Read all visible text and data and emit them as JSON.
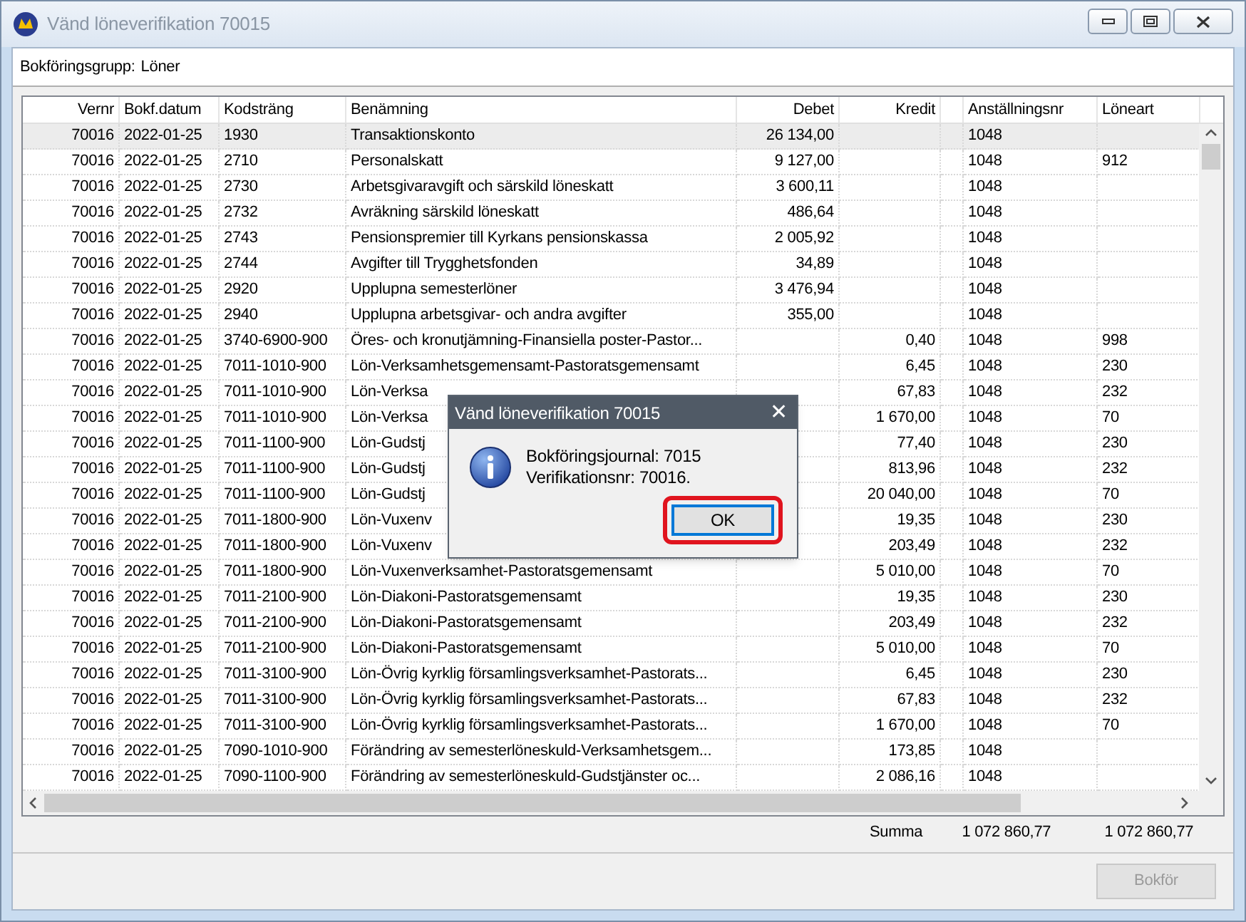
{
  "window": {
    "title": "Vänd löneverifikation 70015"
  },
  "group": {
    "label": "Bokföringsgrupp:",
    "value": "Löner"
  },
  "table": {
    "columns": [
      "Vernr",
      "Bokf.datum",
      "Kodsträng",
      "Benämning",
      "Debet",
      "Kredit",
      "Anställningsnr",
      "Löneart"
    ],
    "rows": [
      {
        "selected": true,
        "vernr": "70016",
        "datum": "2022-01-25",
        "kod": "1930",
        "benamning": "Transaktionskonto",
        "debet": "26 134,00",
        "anst": "1048"
      },
      {
        "selected": false,
        "vernr": "70016",
        "datum": "2022-01-25",
        "kod": "2710",
        "benamning": "Personalskatt",
        "debet": "9 127,00",
        "anst": "1048",
        "loneart": "912"
      },
      {
        "selected": false,
        "vernr": "70016",
        "datum": "2022-01-25",
        "kod": "2730",
        "benamning": "Arbetsgivaravgift och särskild löneskatt",
        "debet": "3 600,11",
        "anst": "1048"
      },
      {
        "selected": false,
        "vernr": "70016",
        "datum": "2022-01-25",
        "kod": "2732",
        "benamning": "Avräkning särskild löneskatt",
        "debet": "486,64",
        "anst": "1048"
      },
      {
        "selected": false,
        "vernr": "70016",
        "datum": "2022-01-25",
        "kod": "2743",
        "benamning": "Pensionspremier till Kyrkans pensionskassa",
        "debet": "2 005,92",
        "anst": "1048"
      },
      {
        "selected": false,
        "vernr": "70016",
        "datum": "2022-01-25",
        "kod": "2744",
        "benamning": "Avgifter till Trygghetsfonden",
        "debet": "34,89",
        "anst": "1048"
      },
      {
        "selected": false,
        "vernr": "70016",
        "datum": "2022-01-25",
        "kod": "2920",
        "benamning": "Upplupna semesterlöner",
        "debet": "3 476,94",
        "anst": "1048"
      },
      {
        "selected": false,
        "vernr": "70016",
        "datum": "2022-01-25",
        "kod": "2940",
        "benamning": "Upplupna arbetsgivar- och andra avgifter",
        "debet": "355,00",
        "anst": "1048"
      },
      {
        "selected": false,
        "vernr": "70016",
        "datum": "2022-01-25",
        "kod": "3740-6900-900",
        "benamning": "Öres- och kronutjämning-Finansiella poster-Pastor...",
        "kredit": "0,40",
        "anst": "1048",
        "loneart": "998"
      },
      {
        "selected": false,
        "vernr": "70016",
        "datum": "2022-01-25",
        "kod": "7011-1010-900",
        "benamning": "Lön-Verksamhetsgemensamt-Pastoratsgemensamt",
        "kredit": "6,45",
        "anst": "1048",
        "loneart": "230"
      },
      {
        "selected": false,
        "vernr": "70016",
        "datum": "2022-01-25",
        "kod": "7011-1010-900",
        "benamning": "Lön-Verksa",
        "kredit": "67,83",
        "anst": "1048",
        "loneart": "232"
      },
      {
        "selected": false,
        "vernr": "70016",
        "datum": "2022-01-25",
        "kod": "7011-1010-900",
        "benamning": "Lön-Verksa",
        "kredit": "1 670,00",
        "anst": "1048",
        "loneart": "70"
      },
      {
        "selected": false,
        "vernr": "70016",
        "datum": "2022-01-25",
        "kod": "7011-1100-900",
        "benamning": "Lön-Gudstj",
        "kredit": "77,40",
        "anst": "1048",
        "loneart": "230"
      },
      {
        "selected": false,
        "vernr": "70016",
        "datum": "2022-01-25",
        "kod": "7011-1100-900",
        "benamning": "Lön-Gudstj",
        "kredit": "813,96",
        "anst": "1048",
        "loneart": "232"
      },
      {
        "selected": false,
        "vernr": "70016",
        "datum": "2022-01-25",
        "kod": "7011-1100-900",
        "benamning": "Lön-Gudstj",
        "kredit": "20 040,00",
        "anst": "1048",
        "loneart": "70"
      },
      {
        "selected": false,
        "vernr": "70016",
        "datum": "2022-01-25",
        "kod": "7011-1800-900",
        "benamning": "Lön-Vuxenv",
        "kredit": "19,35",
        "anst": "1048",
        "loneart": "230"
      },
      {
        "selected": false,
        "vernr": "70016",
        "datum": "2022-01-25",
        "kod": "7011-1800-900",
        "benamning": "Lön-Vuxenv",
        "kredit": "203,49",
        "anst": "1048",
        "loneart": "232"
      },
      {
        "selected": false,
        "vernr": "70016",
        "datum": "2022-01-25",
        "kod": "7011-1800-900",
        "benamning": "Lön-Vuxenverksamhet-Pastoratsgemensamt",
        "kredit": "5 010,00",
        "anst": "1048",
        "loneart": "70"
      },
      {
        "selected": false,
        "vernr": "70016",
        "datum": "2022-01-25",
        "kod": "7011-2100-900",
        "benamning": "Lön-Diakoni-Pastoratsgemensamt",
        "kredit": "19,35",
        "anst": "1048",
        "loneart": "230"
      },
      {
        "selected": false,
        "vernr": "70016",
        "datum": "2022-01-25",
        "kod": "7011-2100-900",
        "benamning": "Lön-Diakoni-Pastoratsgemensamt",
        "kredit": "203,49",
        "anst": "1048",
        "loneart": "232"
      },
      {
        "selected": false,
        "vernr": "70016",
        "datum": "2022-01-25",
        "kod": "7011-2100-900",
        "benamning": "Lön-Diakoni-Pastoratsgemensamt",
        "kredit": "5 010,00",
        "anst": "1048",
        "loneart": "70"
      },
      {
        "selected": false,
        "vernr": "70016",
        "datum": "2022-01-25",
        "kod": "7011-3100-900",
        "benamning": "Lön-Övrig kyrklig församlingsverksamhet-Pastorats...",
        "kredit": "6,45",
        "anst": "1048",
        "loneart": "230"
      },
      {
        "selected": false,
        "vernr": "70016",
        "datum": "2022-01-25",
        "kod": "7011-3100-900",
        "benamning": "Lön-Övrig kyrklig församlingsverksamhet-Pastorats...",
        "kredit": "67,83",
        "anst": "1048",
        "loneart": "232"
      },
      {
        "selected": false,
        "vernr": "70016",
        "datum": "2022-01-25",
        "kod": "7011-3100-900",
        "benamning": "Lön-Övrig kyrklig församlingsverksamhet-Pastorats...",
        "kredit": "1 670,00",
        "anst": "1048",
        "loneart": "70"
      },
      {
        "selected": false,
        "vernr": "70016",
        "datum": "2022-01-25",
        "kod": "7090-1010-900",
        "benamning": "Förändring av semesterlöneskuld-Verksamhetsgem...",
        "kredit": "173,85",
        "anst": "1048"
      },
      {
        "selected": false,
        "vernr": "70016",
        "datum": "2022-01-25",
        "kod": "7090-1100-900",
        "benamning": "Förändring av semesterlöneskuld-Gudstjänster oc...",
        "kredit": "2 086,16",
        "anst": "1048"
      }
    ]
  },
  "totals": {
    "label": "Summa",
    "debet": "1 072 860,77",
    "kredit": "1 072 860,77"
  },
  "footer": {
    "button": {
      "label": "Bokför",
      "disabled": true
    }
  },
  "dialog": {
    "title": "Vänd löneverifikation 70015",
    "close": "✕",
    "lines": [
      "Bokföringsjournal: 7015",
      "Verifikationsnr: 70016."
    ],
    "button": {
      "label": "OK",
      "highlighted": true
    }
  }
}
